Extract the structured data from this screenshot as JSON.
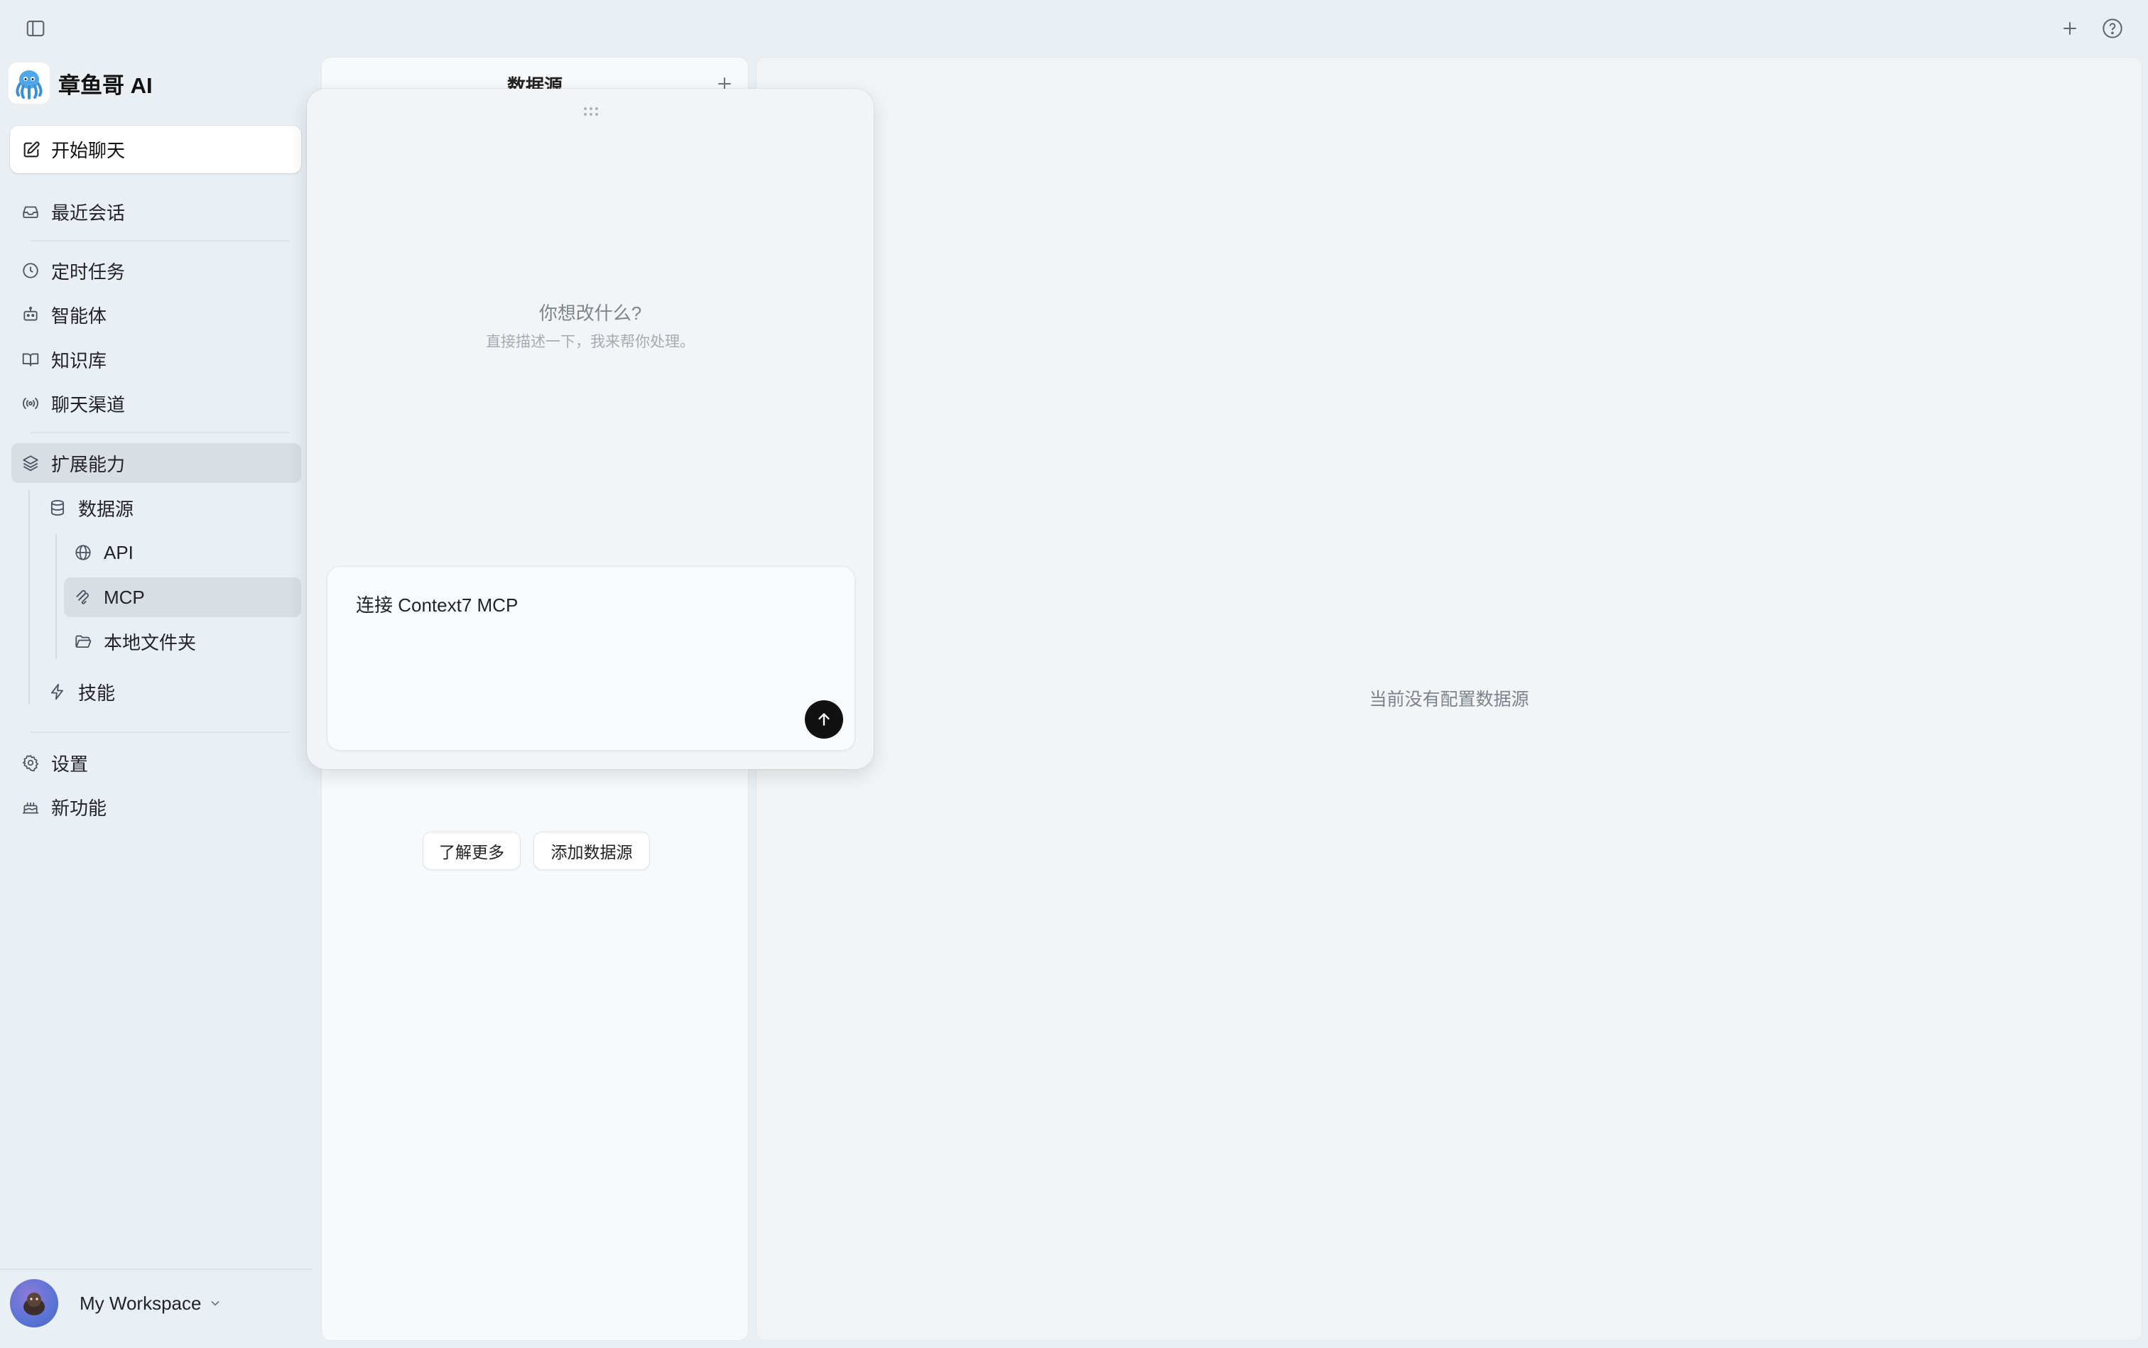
{
  "brand": {
    "name": "章鱼哥 AI"
  },
  "sidebar": {
    "new_chat": "开始聊天",
    "recent": "最近会话",
    "scheduled": "定时任务",
    "agents": "智能体",
    "knowledge": "知识库",
    "channels": "聊天渠道",
    "extensions": "扩展能力",
    "datasource": "数据源",
    "api": "API",
    "mcp": "MCP",
    "local_folder": "本地文件夹",
    "skills": "技能",
    "settings": "设置",
    "whats_new": "新功能"
  },
  "workspace": {
    "name": "My Workspace"
  },
  "list_panel": {
    "title": "数据源",
    "learn_more": "了解更多",
    "add_datasource": "添加数据源"
  },
  "main": {
    "empty_message": "当前没有配置数据源"
  },
  "popup": {
    "title": "你想改什么?",
    "subtitle": "直接描述一下，我来帮你处理。",
    "input_value": "连接 Context7 MCP"
  }
}
